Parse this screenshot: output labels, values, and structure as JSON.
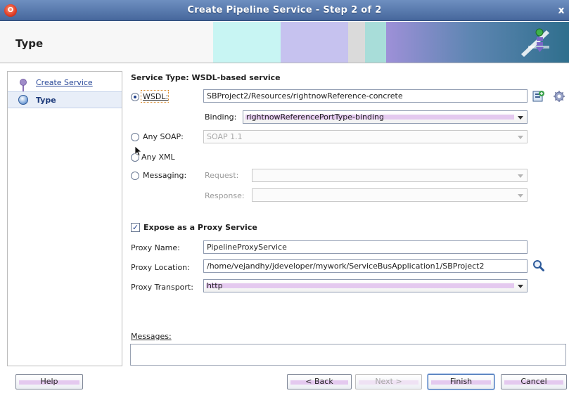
{
  "window": {
    "title": "Create Pipeline Service - Step 2 of 2",
    "close_glyph": "x",
    "app_icon_glyph": "O"
  },
  "header": {
    "title": "Type"
  },
  "nav": {
    "items": [
      {
        "label": "Create Service",
        "state": "visited"
      },
      {
        "label": "Type",
        "state": "current"
      }
    ]
  },
  "form": {
    "service_type_title": "Service Type: WSDL-based service",
    "wsdl": {
      "label": "WSDL:",
      "value": "SBProject2/Resources/rightnowReference-concrete",
      "selected": true
    },
    "binding": {
      "label": "Binding:",
      "value": "rightnowReferencePortType-binding"
    },
    "any_soap": {
      "label": "Any SOAP:",
      "value": "SOAP 1.1",
      "selected": false
    },
    "any_xml": {
      "label": "Any XML",
      "selected": false
    },
    "messaging": {
      "label": "Messaging:",
      "selected": false
    },
    "request": {
      "label": "Request:",
      "value": ""
    },
    "response": {
      "label": "Response:",
      "value": ""
    },
    "expose_proxy": {
      "label": "Expose as a Proxy Service",
      "checked": true
    },
    "proxy_name": {
      "label": "Proxy Name:",
      "value": "PipelineProxyService"
    },
    "proxy_location": {
      "label": "Proxy Location:",
      "value": "/home/vejandhy/jdeveloper/mywork/ServiceBusApplication1/SBProject2"
    },
    "proxy_transport": {
      "label": "Proxy Transport:",
      "value": "http"
    },
    "messages": {
      "label": "Messages:",
      "value": ""
    }
  },
  "buttons": {
    "help": "Help",
    "back": "< Back",
    "next": "Next >",
    "finish": "Finish",
    "cancel": "Cancel"
  },
  "icons": {
    "wsdl_browse": "wsdl-browse-icon",
    "settings": "gear-icon",
    "search": "search-icon",
    "header_graphic": "pipeline-graphic"
  },
  "colors": {
    "titlebar": "#4f6fa3",
    "accent": "#1e3f8a",
    "focus": "#d98a2b"
  }
}
